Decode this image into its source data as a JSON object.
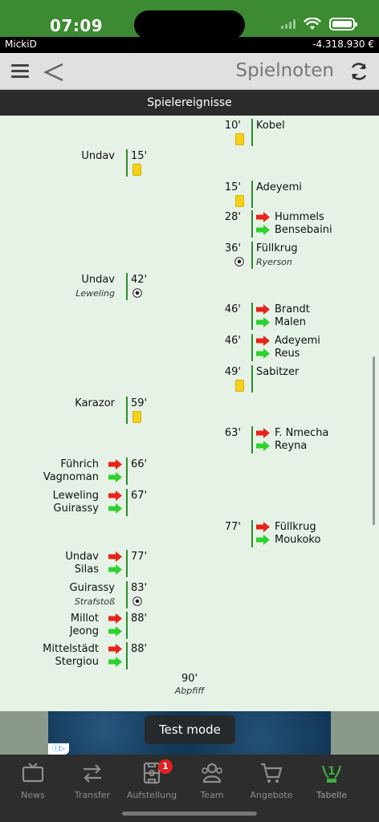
{
  "status_bar": {
    "time": "07:09"
  },
  "account": {
    "name": "MickiD",
    "balance": "-4.318.930 €"
  },
  "nav": {
    "title": "Spielnoten"
  },
  "section": {
    "title": "Spielereignisse"
  },
  "events": [
    {
      "side": "right",
      "minute": "10'",
      "type": "yellow",
      "player": "Kobel"
    },
    {
      "side": "left",
      "minute": "15'",
      "type": "yellow",
      "player": "Undav"
    },
    {
      "side": "right",
      "minute": "15'",
      "type": "yellow",
      "player": "Adeyemi"
    },
    {
      "side": "right",
      "minute": "28'",
      "type": "sub",
      "out": "Hummels",
      "in": "Bensebaini"
    },
    {
      "side": "right",
      "minute": "36'",
      "type": "goal",
      "player": "Füllkrug",
      "note": "Ryerson"
    },
    {
      "side": "left",
      "minute": "42'",
      "type": "goal",
      "player": "Undav",
      "note": "Leweling"
    },
    {
      "side": "right",
      "minute": "46'",
      "type": "sub",
      "out": "Brandt",
      "in": "Malen"
    },
    {
      "side": "right",
      "minute": "46'",
      "type": "sub",
      "out": "Adeyemi",
      "in": "Reus"
    },
    {
      "side": "right",
      "minute": "49'",
      "type": "yellow",
      "player": "Sabitzer"
    },
    {
      "side": "left",
      "minute": "59'",
      "type": "yellow",
      "player": "Karazor"
    },
    {
      "side": "right",
      "minute": "63'",
      "type": "sub",
      "out": "F. Nmecha",
      "in": "Reyna"
    },
    {
      "side": "left",
      "minute": "66'",
      "type": "sub",
      "out": "Führich",
      "in": "Vagnoman"
    },
    {
      "side": "left",
      "minute": "67'",
      "type": "sub",
      "out": "Leweling",
      "in": "Guirassy"
    },
    {
      "side": "right",
      "minute": "77'",
      "type": "sub",
      "out": "Füllkrug",
      "in": "Moukoko"
    },
    {
      "side": "left",
      "minute": "77'",
      "type": "sub",
      "out": "Undav",
      "in": "Silas"
    },
    {
      "side": "left",
      "minute": "83'",
      "type": "goal",
      "player": "Guirassy",
      "note": "Strafstoß"
    },
    {
      "side": "left",
      "minute": "88'",
      "type": "sub",
      "out": "Millot",
      "in": "Jeong"
    },
    {
      "side": "left",
      "minute": "88'",
      "type": "sub",
      "out": "Mittelstädt",
      "in": "Stergiou"
    }
  ],
  "final": {
    "minute": "90'",
    "label": "Abpfiff"
  },
  "ad": {
    "toast": "Test mode",
    "info_icon": "info-icon"
  },
  "tabs": [
    {
      "label": "News",
      "icon": "tv-icon"
    },
    {
      "label": "Transfer",
      "icon": "transfer-arrows-icon"
    },
    {
      "label": "Aufstellung",
      "icon": "lineup-icon",
      "badge": "1"
    },
    {
      "label": "Team",
      "icon": "team-icon"
    },
    {
      "label": "Angebote",
      "icon": "cart-icon"
    },
    {
      "label": "Tabelle",
      "icon": "table-trophy-icon",
      "active": true,
      "rank": "1"
    }
  ],
  "colors": {
    "status_green": "#3c8a31",
    "timeline_green": "#2e8b2e",
    "background": "#e6f2e6",
    "yellow_card": "#f5d21a",
    "sub_out_red": "#e8231a",
    "sub_in_green": "#2ed12e",
    "badge_red": "#e02020",
    "active_tab_green": "#3fae3f"
  }
}
